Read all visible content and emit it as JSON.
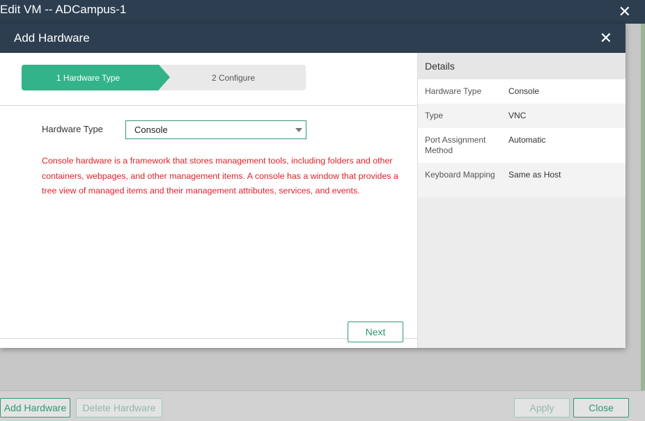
{
  "outer_window": {
    "title": "Edit VM -- ADCampus-1",
    "close_glyph": "✕"
  },
  "modal": {
    "title": "Add Hardware",
    "close_glyph": "✕",
    "steps": [
      {
        "label": "1 Hardware Type",
        "active": true
      },
      {
        "label": "2 Configure",
        "active": false
      }
    ],
    "field": {
      "label": "Hardware Type",
      "value": "Console"
    },
    "description": "Console hardware is a framework that stores management tools, including folders and other containers, webpages, and other management items. A console has a window that provides a tree view of managed items and their management attributes, services, and events.",
    "next_label": "Next",
    "details": {
      "title": "Details",
      "rows": [
        {
          "key": "Hardware Type",
          "value": "Console"
        },
        {
          "key": "Type",
          "value": "VNC"
        },
        {
          "key": "Port Assignment Method",
          "value": "Automatic"
        },
        {
          "key": "Keyboard Mapping",
          "value": "Same as Host"
        }
      ]
    }
  },
  "footer": {
    "add_hardware_label": "Add Hardware",
    "delete_hardware_label": "Delete Hardware",
    "apply_label": "Apply",
    "close_label": "Close"
  },
  "colors": {
    "header_bg": "#2e3e51",
    "accent_green": "#33b389",
    "button_border": "#2e9a6e",
    "description_red": "#e0202a"
  }
}
